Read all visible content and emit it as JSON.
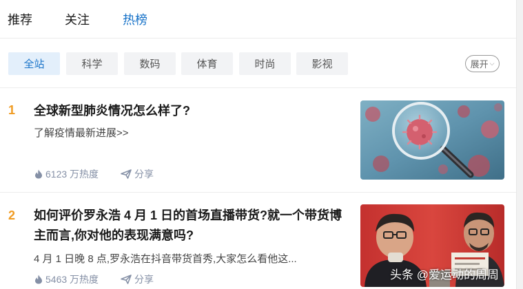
{
  "top_tabs": [
    {
      "label": "推荐"
    },
    {
      "label": "关注"
    },
    {
      "label": "热榜"
    }
  ],
  "active_top_tab": "热榜",
  "categories": [
    {
      "label": "全站"
    },
    {
      "label": "科学"
    },
    {
      "label": "数码"
    },
    {
      "label": "体育"
    },
    {
      "label": "时尚"
    },
    {
      "label": "影视"
    }
  ],
  "active_category": "全站",
  "expand_label": "展开",
  "items": [
    {
      "rank": "1",
      "title": "全球新型肺炎情况怎么样了?",
      "excerpt": "了解疫情最新进展>>",
      "heat": "6123 万热度",
      "share": "分享"
    },
    {
      "rank": "2",
      "title": "如何评价罗永浩 4 月 1 日的首场直播带货?就一个带货博主而言,你对他的表现满意吗?",
      "excerpt": "4 月 1 日晚 8 点,罗永浩在抖音带货首秀,大家怎么看他这...",
      "heat": "5463 万热度",
      "share": "分享"
    }
  ],
  "watermark": "头条 @爱运动的周周",
  "colors": {
    "accent": "#1772c8",
    "rank": "#f09b22",
    "meta": "#8590a6"
  },
  "icons": {
    "heat": "flame-icon",
    "share": "paper-plane-icon",
    "expand": "chevron-down-icon"
  }
}
